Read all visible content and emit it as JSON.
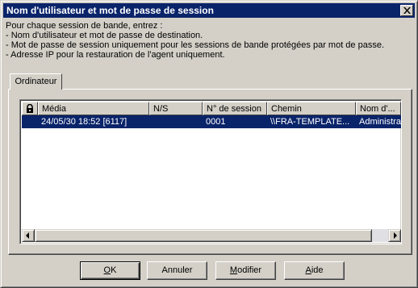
{
  "window": {
    "title": "Nom d'utilisateur et mot de passe de session"
  },
  "intro": {
    "lines": [
      "Pour chaque session de bande, entrez :",
      "- Nom d'utilisateur et mot de passe de destination.",
      "- Mot de passe de session uniquement pour les sessions de bande protégées par mot de passe.",
      "- Adresse IP pour la restauration de l'agent uniquement."
    ]
  },
  "tabs": [
    {
      "label": "Ordinateur",
      "selected": true
    }
  ],
  "list": {
    "columns": [
      {
        "label": "",
        "icon": "lock-icon"
      },
      {
        "label": "Média"
      },
      {
        "label": "N/S"
      },
      {
        "label": "N° de session"
      },
      {
        "label": "Chemin"
      },
      {
        "label": "Nom d'..."
      }
    ],
    "rows": [
      {
        "media": "24/05/30 18:52 [6117]",
        "ns": "",
        "session": "0001",
        "path": "\\\\FRA-TEMPLATE...",
        "name": "Administrat",
        "selected": true
      }
    ]
  },
  "buttons": {
    "ok": {
      "label_u": "O",
      "label_rest": "K"
    },
    "cancel": {
      "label_u": "",
      "label_rest": "Annuler"
    },
    "modify": {
      "label_u": "M",
      "label_rest": "odifier"
    },
    "help": {
      "label_u": "A",
      "label_rest": "ide"
    }
  },
  "colors": {
    "titlebar": "#0a246a",
    "selection": "#0a246a",
    "face": "#d4d0c8"
  }
}
